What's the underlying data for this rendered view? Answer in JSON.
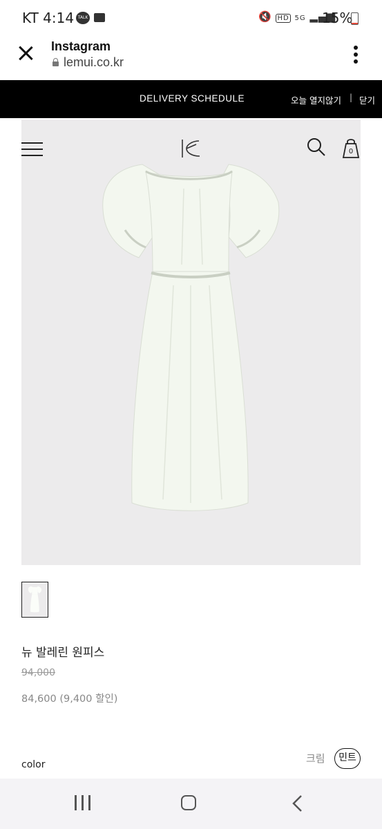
{
  "status_bar": {
    "carrier_time": "KT 4:14",
    "talk_badge": "TALK",
    "hd_badge": "HD",
    "network": "5G",
    "battery": "15%",
    "battery_level": 0.15
  },
  "browser": {
    "app_title": "Instagram",
    "url": "lemui.co.kr"
  },
  "banner": {
    "text": "DELIVERY SCHEDULE",
    "hide_today": "오늘 열지않기",
    "separator": "|",
    "close": "닫기"
  },
  "header": {
    "cart_count": "0"
  },
  "product": {
    "name": "뉴 발레린 원피스",
    "original_price": "94,000",
    "sale_price": "84,600 (9,400 할인)",
    "color_label": "color",
    "color_options": [
      "크림",
      "민트"
    ],
    "selected_color": "민트"
  },
  "colors": {
    "banner_bg": "#000000",
    "image_bg": "#ecebec",
    "dress": "#f3f7ef"
  }
}
